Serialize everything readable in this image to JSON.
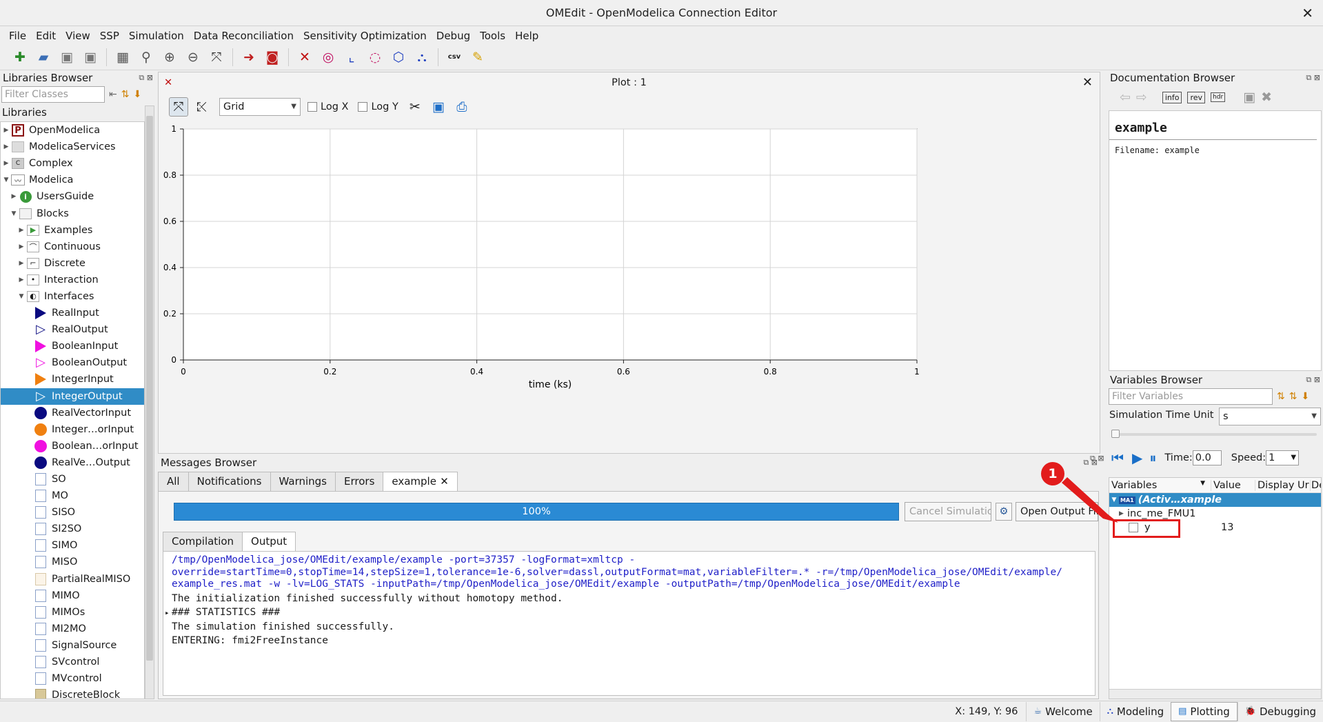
{
  "window": {
    "title": "OMEdit - OpenModelica Connection Editor",
    "close": "✕"
  },
  "menu": [
    "File",
    "Edit",
    "View",
    "SSP",
    "Simulation",
    "Data Reconciliation",
    "Sensitivity Optimization",
    "Debug",
    "Tools",
    "Help"
  ],
  "toolbar_icons": [
    "new-file-icon",
    "open-icon",
    "save-icon",
    "save-all-icon",
    "grid-icon",
    "zoom-icon",
    "zoom-in-icon",
    "zoom-out-icon",
    "fit-icon",
    "check-model-icon",
    "instantiate-icon",
    "plot-icon",
    "parametric-plot-icon",
    "array-plot-icon",
    "array-parametric-icon",
    "3d-icon",
    "diagram-icon",
    "export-csv-icon",
    "clear-icon"
  ],
  "libraries": {
    "title": "Libraries Browser",
    "filter_placeholder": "Filter Classes",
    "tree_header": "Libraries",
    "items": [
      {
        "label": "OpenModelica",
        "depth": 0,
        "arrow": "right",
        "icon": "P"
      },
      {
        "label": "ModelicaServices",
        "depth": 0,
        "arrow": "right",
        "icon": ""
      },
      {
        "label": "Complex",
        "depth": 0,
        "arrow": "right",
        "icon": "C"
      },
      {
        "label": "Modelica",
        "depth": 0,
        "arrow": "down",
        "icon": "M"
      },
      {
        "label": "UsersGuide",
        "depth": 1,
        "arrow": "right",
        "icon": "i"
      },
      {
        "label": "Blocks",
        "depth": 1,
        "arrow": "down",
        "icon": "B"
      },
      {
        "label": "Examples",
        "depth": 2,
        "arrow": "right",
        "icon": "▶"
      },
      {
        "label": "Continuous",
        "depth": 2,
        "arrow": "right",
        "icon": "~"
      },
      {
        "label": "Discrete",
        "depth": 2,
        "arrow": "right",
        "icon": "-"
      },
      {
        "label": "Interaction",
        "depth": 2,
        "arrow": "right",
        "icon": "·"
      },
      {
        "label": "Interfaces",
        "depth": 2,
        "arrow": "down",
        "icon": "◐"
      },
      {
        "label": "RealInput",
        "depth": 3,
        "arrow": "",
        "icon": "tri-navy"
      },
      {
        "label": "RealOutput",
        "depth": 3,
        "arrow": "",
        "icon": "tri-outline"
      },
      {
        "label": "BooleanInput",
        "depth": 3,
        "arrow": "",
        "icon": "tri-magenta"
      },
      {
        "label": "BooleanOutput",
        "depth": 3,
        "arrow": "",
        "icon": "tri-outline-magenta"
      },
      {
        "label": "IntegerInput",
        "depth": 3,
        "arrow": "",
        "icon": "tri-orange"
      },
      {
        "label": "IntegerOutput",
        "depth": 3,
        "arrow": "",
        "icon": "tri-outline-white",
        "selected": true
      },
      {
        "label": "RealVectorInput",
        "depth": 3,
        "arrow": "",
        "icon": "circ-navy"
      },
      {
        "label": "Integer…orInput",
        "depth": 3,
        "arrow": "",
        "icon": "circ-orange"
      },
      {
        "label": "Boolean…orInput",
        "depth": 3,
        "arrow": "",
        "icon": "circ-magenta"
      },
      {
        "label": "RealVe…Output",
        "depth": 3,
        "arrow": "",
        "icon": "circ-navy"
      },
      {
        "label": "SO",
        "depth": 3,
        "arrow": "",
        "icon": "box"
      },
      {
        "label": "MO",
        "depth": 3,
        "arrow": "",
        "icon": "box"
      },
      {
        "label": "SISO",
        "depth": 3,
        "arrow": "",
        "icon": "box"
      },
      {
        "label": "SI2SO",
        "depth": 3,
        "arrow": "",
        "icon": "box"
      },
      {
        "label": "SIMO",
        "depth": 3,
        "arrow": "",
        "icon": "box"
      },
      {
        "label": "MISO",
        "depth": 3,
        "arrow": "",
        "icon": "box"
      },
      {
        "label": "PartialRealMISO",
        "depth": 3,
        "arrow": "",
        "icon": "box-beige"
      },
      {
        "label": "MIMO",
        "depth": 3,
        "arrow": "",
        "icon": "box"
      },
      {
        "label": "MIMOs",
        "depth": 3,
        "arrow": "",
        "icon": "box"
      },
      {
        "label": "MI2MO",
        "depth": 3,
        "arrow": "",
        "icon": "box"
      },
      {
        "label": "SignalSource",
        "depth": 3,
        "arrow": "",
        "icon": "box"
      },
      {
        "label": "SVcontrol",
        "depth": 3,
        "arrow": "",
        "icon": "box"
      },
      {
        "label": "MVcontrol",
        "depth": 3,
        "arrow": "",
        "icon": "box"
      },
      {
        "label": "DiscreteBlock",
        "depth": 3,
        "arrow": "",
        "icon": "box-tan"
      }
    ]
  },
  "plot": {
    "window_title": "Plot : 1",
    "grid_mode": "Grid",
    "logx_label": "Log X",
    "logy_label": "Log Y",
    "logx_checked": false,
    "logy_checked": false,
    "xlabel": "time (ks)"
  },
  "chart_data": {
    "type": "line",
    "series": [],
    "xlim": [
      0,
      1
    ],
    "ylim": [
      0,
      1
    ],
    "x_ticks": [
      "0",
      "0.2",
      "0.4",
      "0.6",
      "0.8",
      "1"
    ],
    "y_ticks": [
      "0",
      "0.2",
      "0.4",
      "0.6",
      "0.8",
      "1"
    ],
    "xlabel": "time (ks)",
    "grid": true
  },
  "messages": {
    "title": "Messages Browser",
    "tabs": [
      "All",
      "Notifications",
      "Warnings",
      "Errors",
      "example"
    ],
    "active_tab": "example",
    "progress_label": "100%",
    "progress": 1.0,
    "cancel_button": "Cancel Simulation",
    "open_output_button": "Open Output File",
    "subtabs": [
      "Compilation",
      "Output"
    ],
    "active_subtab": "Output",
    "command": "/tmp/OpenModelica_jose/OMEdit/example/example -port=37357 -logFormat=xmltcp -\noverride=startTime=0,stopTime=14,stepSize=1,tolerance=1e-6,solver=dassl,outputFormat=mat,variableFilter=.* -r=/tmp/OpenModelica_jose/OMEdit/example/\nexample_res.mat -w -lv=LOG_STATS -inputPath=/tmp/OpenModelica_jose/OMEdit/example -outputPath=/tmp/OpenModelica_jose/OMEdit/example",
    "lines": [
      {
        "text": "The initialization finished successfully without homotopy method.",
        "expandable": false
      },
      {
        "text": "### STATISTICS ###",
        "expandable": true
      },
      {
        "text": "The simulation finished successfully.",
        "expandable": false
      },
      {
        "text": "ENTERING: fmi2FreeInstance",
        "expandable": false
      }
    ]
  },
  "documentation": {
    "title": "Documentation Browser",
    "class_name": "example",
    "filename_text": "Filename: example"
  },
  "variables": {
    "title": "Variables Browser",
    "filter_placeholder": "Filter Variables",
    "time_unit_label": "Simulation Time Unit",
    "time_unit_value": "s",
    "time_label": "Time:",
    "time_value": "0.0",
    "speed_label": "Speed:",
    "speed_value": "1",
    "columns": [
      "Variables",
      "Value",
      "Display Ur",
      "De"
    ],
    "rows": [
      {
        "label": "(Activ…xample",
        "badge": "MA1",
        "selected": true,
        "depth": 0,
        "value": ""
      },
      {
        "label": "inc_me_FMU1",
        "depth": 1,
        "value": ""
      },
      {
        "label": "y",
        "depth": 1,
        "checkbox": true,
        "value": "13"
      }
    ]
  },
  "annotation": {
    "badge": "1",
    "color": "#e21c1c"
  },
  "status": {
    "coords": "X: 149, Y: 96",
    "perspectives": [
      "Welcome",
      "Modeling",
      "Plotting",
      "Debugging"
    ],
    "active": "Plotting"
  }
}
